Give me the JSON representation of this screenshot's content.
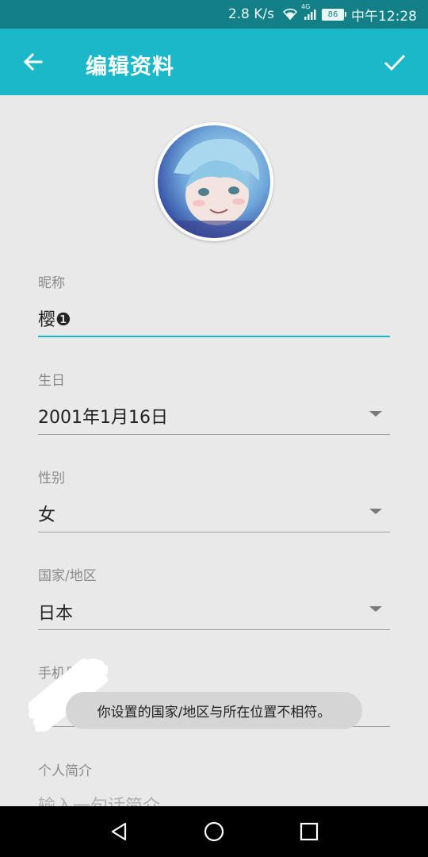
{
  "status_bar": {
    "speed": "2.8 K/s",
    "network": "4G",
    "battery": "86",
    "time": "中午12:28"
  },
  "app_bar": {
    "title": "编辑资料",
    "back_icon": "arrow-left-icon",
    "confirm_icon": "check-icon",
    "color": "#1ab8c8"
  },
  "form": {
    "nickname": {
      "label": "昵称",
      "value": "樱❶"
    },
    "birthday": {
      "label": "生日",
      "value": "2001年1月16日"
    },
    "gender": {
      "label": "性别",
      "value": "女"
    },
    "region": {
      "label": "国家/地区",
      "value": "日本"
    },
    "phone": {
      "label": "手机号"
    },
    "bio": {
      "label": "个人简介",
      "placeholder": "输入一句话简介"
    }
  },
  "toast": "你设置的国家/地区与所在位置不相符。",
  "nav_bar": {
    "back_icon": "triangle-back-icon",
    "home_icon": "circle-home-icon",
    "recents_icon": "square-recents-icon"
  }
}
